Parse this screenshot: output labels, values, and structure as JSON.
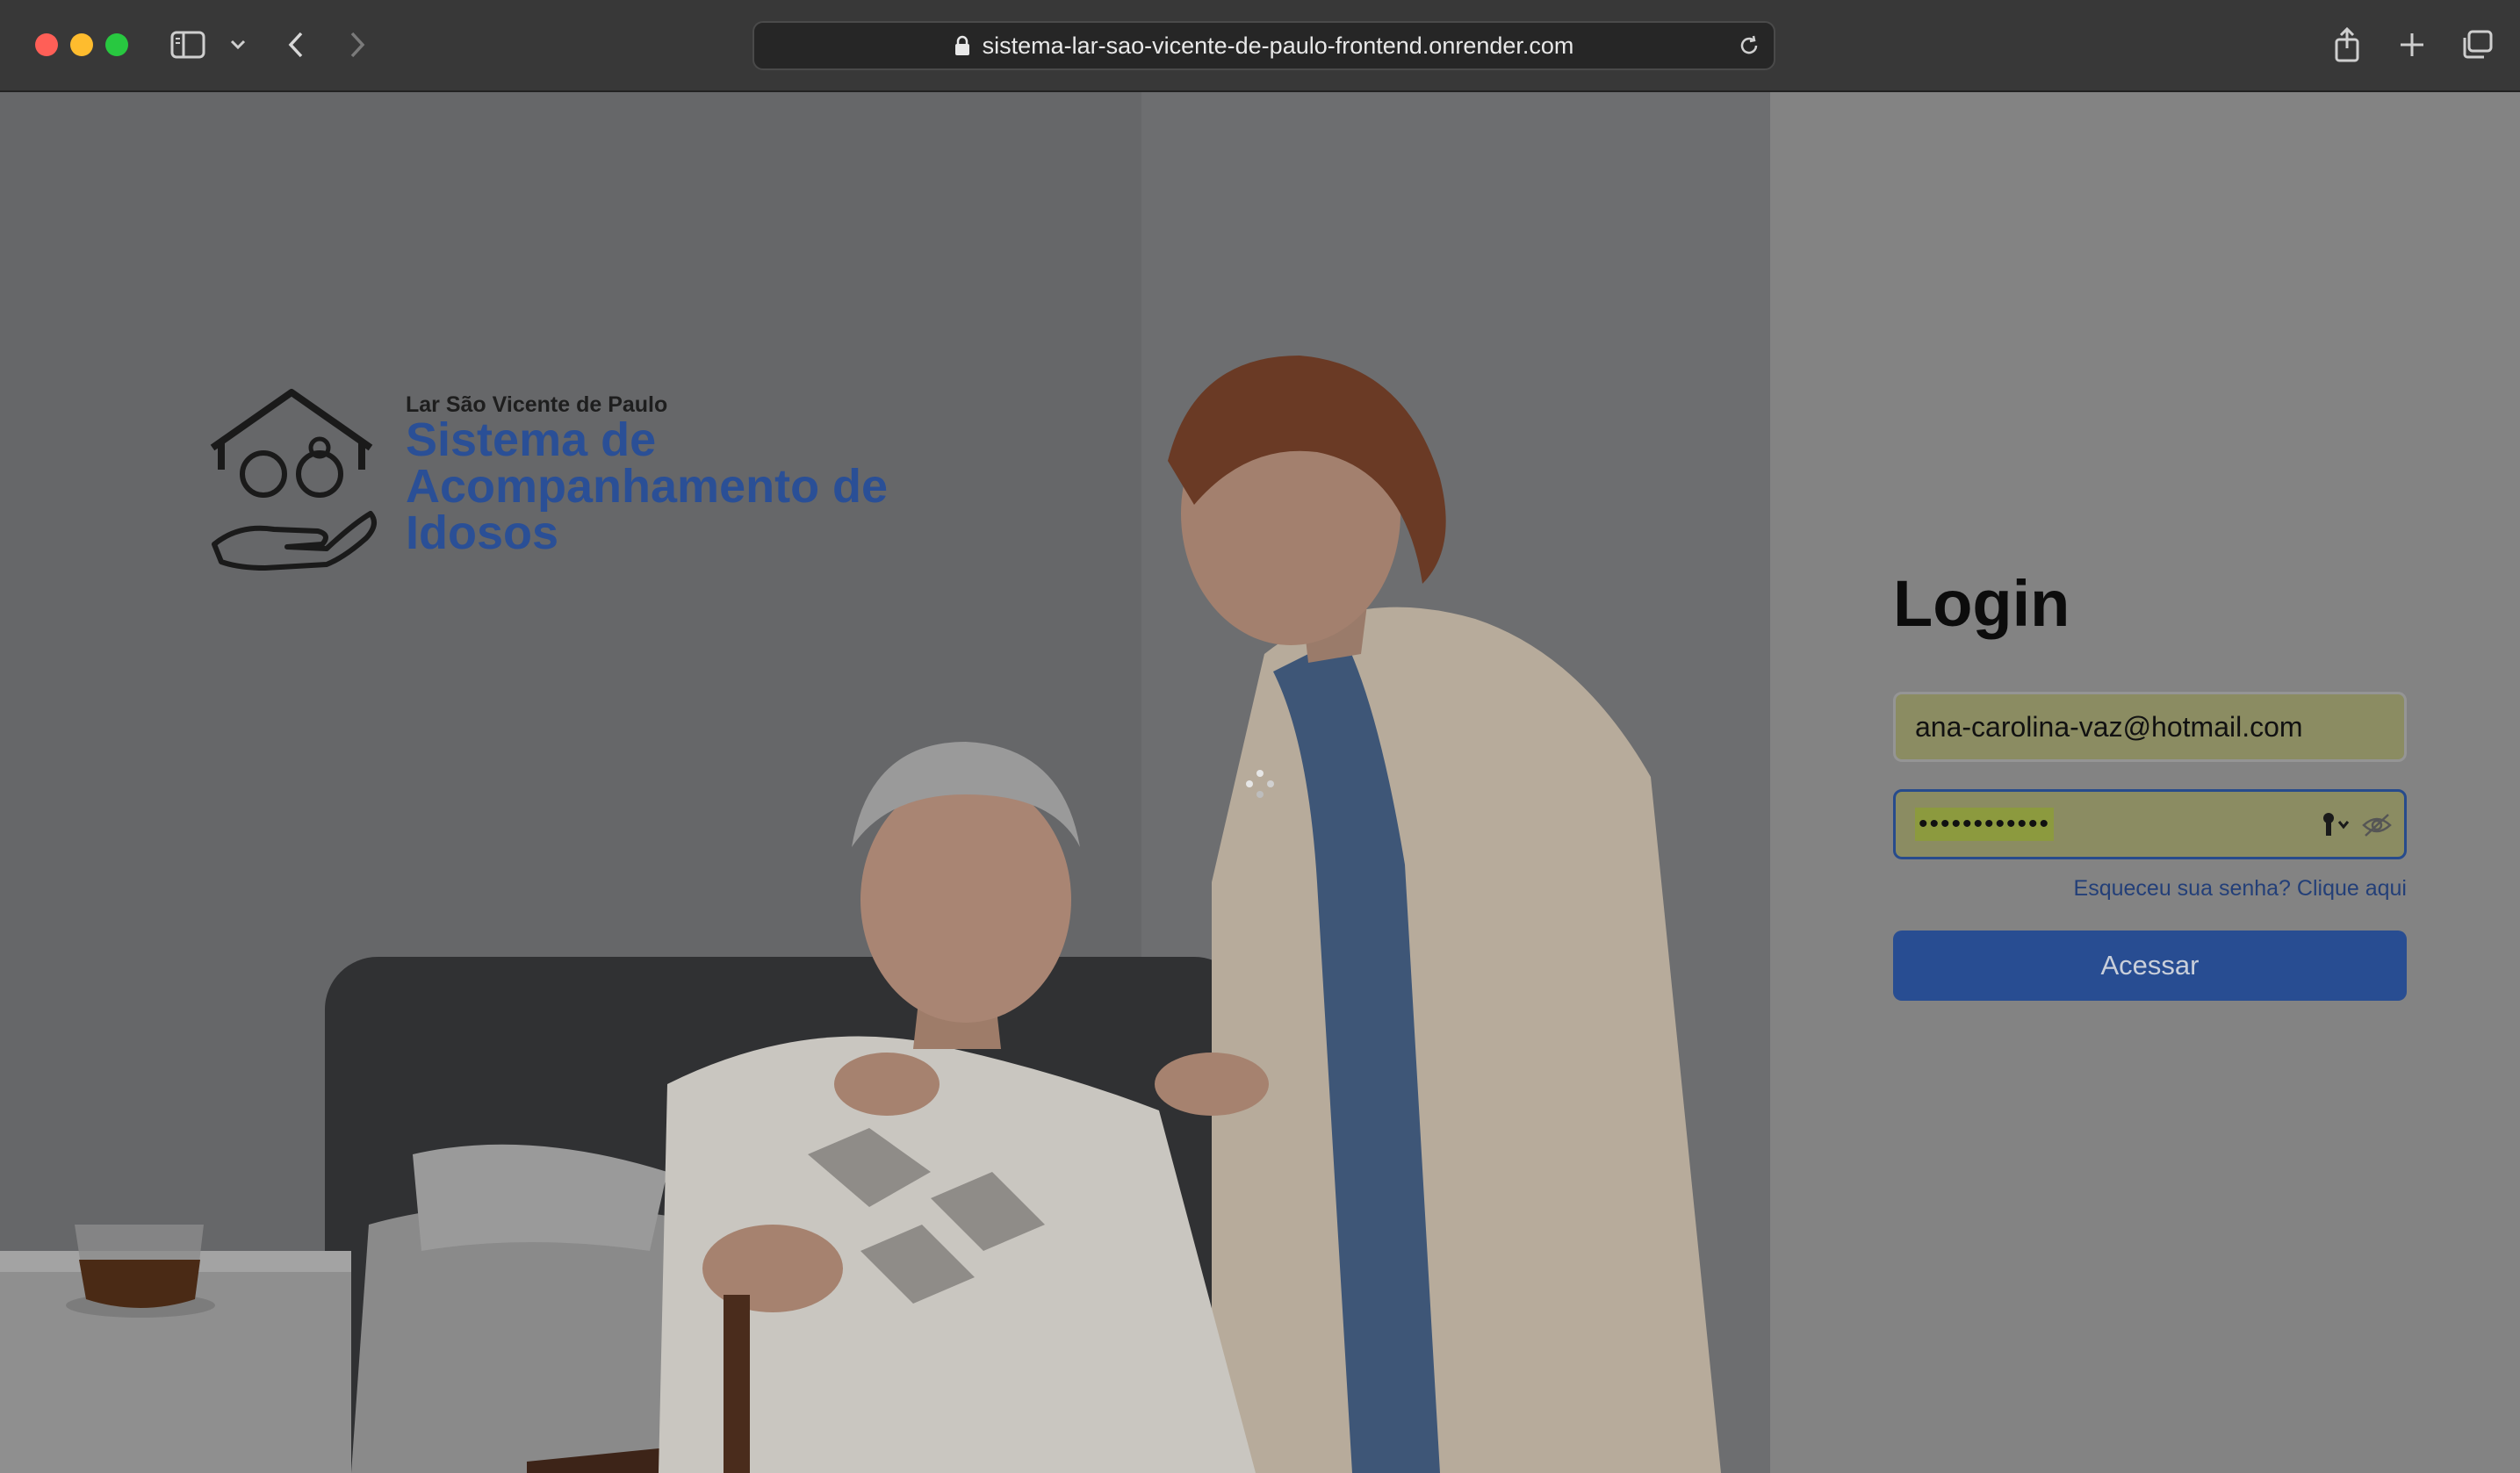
{
  "browser": {
    "url": "sistema-lar-sao-vicente-de-paulo-frontend.onrender.com",
    "icons": [
      "close-icon",
      "minimize-icon",
      "maximize-icon",
      "sidebar-icon",
      "chevron-down-icon",
      "back-icon",
      "forward-icon",
      "lock-icon",
      "reload-icon",
      "share-icon",
      "plus-icon",
      "tabs-icon"
    ]
  },
  "brand": {
    "subtitle": "Lar São Vicente de Paulo",
    "title": "Sistema de Acompanhamento de Idosos",
    "logo_icon": "house-hand-elderly-icon",
    "accent": "#2a4f96"
  },
  "login": {
    "title": "Login",
    "email_value": "ana-carolina-vaz@hotmail.com",
    "password_mask": "••••••••••••",
    "forgot_link": "Esqueceu sua senha? Clique aqui",
    "submit_label": "Acessar",
    "button_color": "#284d92"
  }
}
